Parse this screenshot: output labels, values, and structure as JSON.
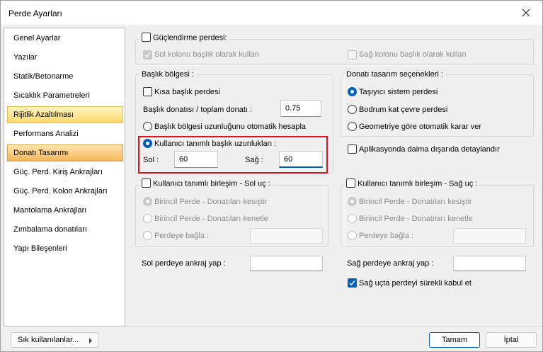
{
  "window": {
    "title": "Perde Ayarları"
  },
  "sidebar": {
    "items": [
      "Genel Ayarlar",
      "Yazılar",
      "Statik/Betonarme",
      "Sıcaklık Parametreleri",
      "Rijitlik Azaltılması",
      "Performans Analizi",
      "Donatı Tasarımı",
      "Güç. Perd. Kiriş Ankrajları",
      "Güç. Perd. Kolon Ankrajları",
      "Mantolama Ankrajları",
      "Zımbalama donatıları",
      "Yapı Bileşenleri"
    ],
    "selected": [
      "Rijitlik Azaltılması",
      "Donatı Tasarımı"
    ]
  },
  "gucl": {
    "label": "Güçlendirme perdesi:",
    "left": "Sol kolonu başlık olarak kullan",
    "right": "Sağ kolonu başlık olarak kullan"
  },
  "baslik": {
    "group": "Başlık bölgesi :",
    "kisa": "Kısa başlık perdesi",
    "oran_label": "Başlık donatısı / toplam donatı :",
    "oran_value": "0.75",
    "otomatik": "Başlık bölgesi uzunluğunu otomatik hesapla",
    "kullanici": "Kullanıcı tanımlı başlık uzunlukları :",
    "sol_label": "Sol :",
    "sol_value": "60",
    "sag_label": "Sağ :",
    "sag_value": "60"
  },
  "donati": {
    "group": "Donatı tasarım seçenekleri :",
    "opt1": "Taşıyıcı sistem perdesi",
    "opt2": "Bodrum kat çevre perdesi",
    "opt3": "Geometriye göre otomatik karar ver",
    "aplikasyon": "Aplikasyonda daima dışarıda detaylandır"
  },
  "birlesim_sol": {
    "group": "Kullanıcı tanımlı birleşim - Sol uç :",
    "opt1": "Birincil Perde - Donatıları kesiştir",
    "opt2": "Birincil Perde - Donatıları kenetle",
    "opt3": "Perdeye bağla :"
  },
  "birlesim_sag": {
    "group": "Kullanıcı tanımlı birleşim - Sağ uç :",
    "opt1": "Birincil Perde - Donatıları kesiştir",
    "opt2": "Birincil Perde - Donatıları kenetle",
    "opt3": "Perdeye bağla :"
  },
  "ankraj": {
    "sol": "Sol perdeye ankraj yap :",
    "sag": "Sağ perdeye ankraj yap :",
    "surekli": "Sağ uçta perdeyi sürekli kabul et"
  },
  "footer": {
    "sik": "Sık kullanılanlar...",
    "tamam": "Tamam",
    "iptal": "İptal"
  }
}
